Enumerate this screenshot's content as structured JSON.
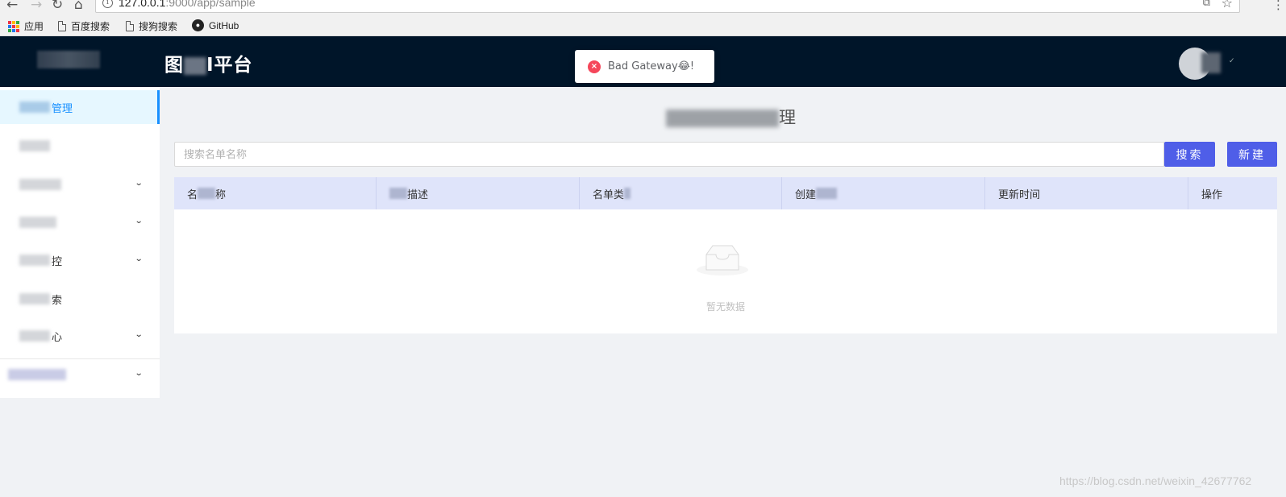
{
  "browser": {
    "url_host": "127.0.0.1",
    "url_rest": ":9000/app/sample",
    "bookmarks": [
      {
        "label": "应用",
        "icon": "apps-grid-icon"
      },
      {
        "label": "百度搜索",
        "icon": "page-icon"
      },
      {
        "label": "搜狗搜索",
        "icon": "page-icon"
      },
      {
        "label": "GitHub",
        "icon": "github-icon"
      }
    ]
  },
  "header": {
    "title_part1": "图",
    "title_part2": "I平台"
  },
  "toast": {
    "type": "error",
    "message": "Bad Gateway😂!"
  },
  "sidebar": {
    "items": [
      {
        "label": "管理",
        "active": true,
        "expandable": false
      },
      {
        "label": "",
        "active": false,
        "expandable": false
      },
      {
        "label": "",
        "active": false,
        "expandable": true
      },
      {
        "label": "",
        "active": false,
        "expandable": true
      },
      {
        "label": "控",
        "active": false,
        "expandable": true
      },
      {
        "label": "索",
        "active": false,
        "expandable": false
      },
      {
        "label": "心",
        "active": false,
        "expandable": true
      },
      {
        "label": "",
        "active": false,
        "expandable": true
      }
    ]
  },
  "main": {
    "title_tail": "理",
    "search_placeholder": "搜索名单名称",
    "search_button": "搜索",
    "new_button": "新建"
  },
  "table": {
    "columns": [
      {
        "pre": "名",
        "post": "称"
      },
      {
        "pre": "",
        "post": "描述"
      },
      {
        "pre": "名单类",
        "post": ""
      },
      {
        "pre": "创建",
        "post": ""
      },
      {
        "pre": "更新时间",
        "post": ""
      },
      {
        "pre": "操作",
        "post": ""
      }
    ],
    "empty_text": "暂无数据"
  },
  "watermark": "https://blog.csdn.net/weixin_42677762",
  "colors": {
    "header_bg": "#001529",
    "primary_button": "#4f5ee8",
    "table_header_bg": "#dfe4fa",
    "active_menu_bg": "#e6f7ff",
    "error": "#f5465a"
  }
}
